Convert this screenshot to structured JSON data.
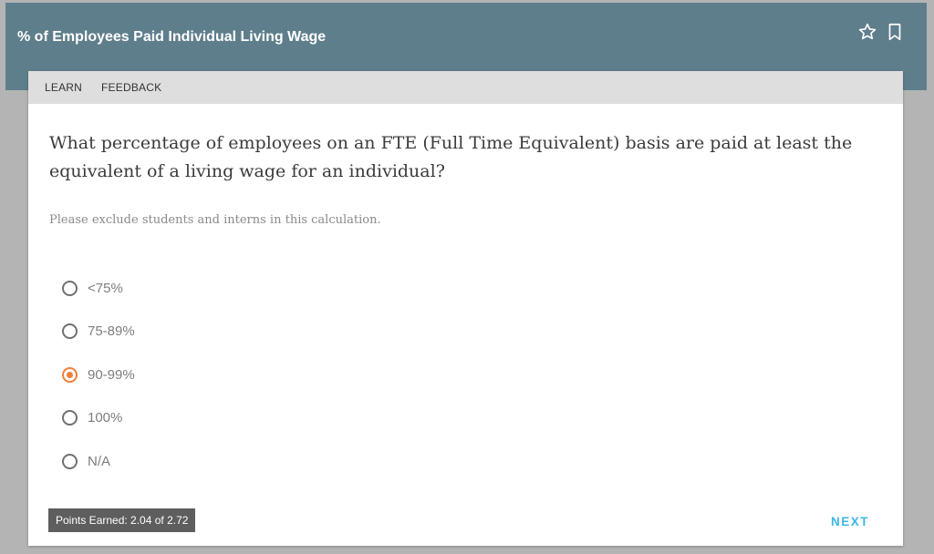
{
  "header": {
    "title": "% of Employees Paid Individual Living Wage",
    "icons": [
      "star-icon",
      "bookmark-icon"
    ]
  },
  "tabs": [
    {
      "label": "LEARN"
    },
    {
      "label": "FEEDBACK"
    }
  ],
  "question": {
    "text": "What percentage of employees on an FTE (Full Time Equivalent) basis are paid at least the equivalent of a living wage for an individual?",
    "hint": "Please exclude students and interns in this calculation."
  },
  "options": [
    {
      "label": "<75%",
      "selected": false
    },
    {
      "label": "75-89%",
      "selected": false
    },
    {
      "label": "90-99%",
      "selected": true
    },
    {
      "label": "100%",
      "selected": false
    },
    {
      "label": "N/A",
      "selected": false
    }
  ],
  "footer": {
    "points": "Points Earned: 2.04 of 2.72",
    "next_label": "NEXT"
  },
  "colors": {
    "header_bg": "#5f7e8c",
    "accent_selected": "#f07f3c",
    "next_link": "#3cb7e6",
    "points_bg": "#5e5e5e"
  }
}
